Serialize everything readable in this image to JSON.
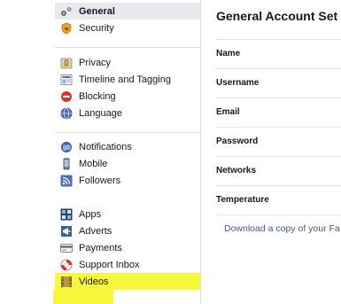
{
  "sidebar": {
    "group1": [
      {
        "label": "General",
        "icon": "gears-icon"
      },
      {
        "label": "Security",
        "icon": "shield-icon"
      }
    ],
    "group2": [
      {
        "label": "Privacy",
        "icon": "lock-icon"
      },
      {
        "label": "Timeline and Tagging",
        "icon": "timeline-icon"
      },
      {
        "label": "Blocking",
        "icon": "block-icon"
      },
      {
        "label": "Language",
        "icon": "globe-icon"
      }
    ],
    "group3": [
      {
        "label": "Notifications",
        "icon": "globe-notification-icon"
      },
      {
        "label": "Mobile",
        "icon": "mobile-icon"
      },
      {
        "label": "Followers",
        "icon": "rss-icon"
      }
    ],
    "group4": [
      {
        "label": "Apps",
        "icon": "apps-icon"
      },
      {
        "label": "Adverts",
        "icon": "megaphone-icon"
      },
      {
        "label": "Payments",
        "icon": "card-icon"
      },
      {
        "label": "Support Inbox",
        "icon": "lifebuoy-icon"
      },
      {
        "label": "Videos",
        "icon": "film-icon"
      }
    ]
  },
  "main": {
    "title": "General Account Set",
    "rows": [
      "Name",
      "Username",
      "Email",
      "Password",
      "Networks",
      "Temperature"
    ],
    "footer_link": "Download a copy",
    "footer_text": " of your Fa"
  },
  "colors": {
    "highlight": "#f7f73b",
    "active_bg": "#e9eaed",
    "link": "#3b5998"
  }
}
